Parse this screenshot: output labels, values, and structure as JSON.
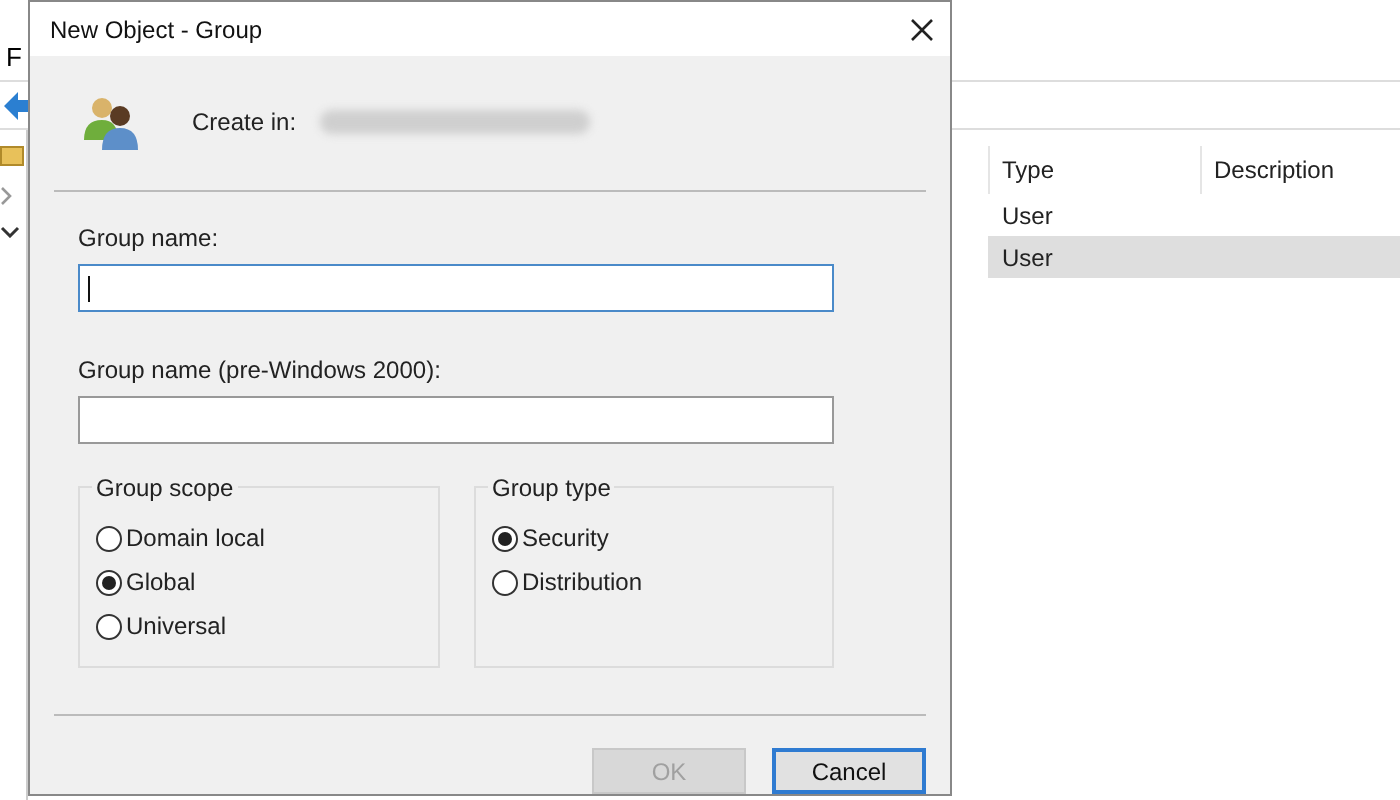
{
  "background": {
    "menu_letter": "F",
    "table": {
      "columns": [
        "Type",
        "Description"
      ],
      "rows": [
        {
          "type": "User",
          "selected": false
        },
        {
          "type": "User",
          "selected": true
        }
      ]
    }
  },
  "dialog": {
    "title": "New Object - Group",
    "create_in_label": "Create in:",
    "fields": [
      {
        "label": "Group name:",
        "focused": true
      },
      {
        "label": "Group name (pre-Windows 2000):",
        "focused": false
      }
    ],
    "group_scope": {
      "title": "Group scope",
      "options": [
        {
          "label": "Domain local",
          "selected": false
        },
        {
          "label": "Global",
          "selected": true
        },
        {
          "label": "Universal",
          "selected": false
        }
      ]
    },
    "group_type": {
      "title": "Group type",
      "options": [
        {
          "label": "Security",
          "selected": true
        },
        {
          "label": "Distribution",
          "selected": false
        }
      ]
    },
    "buttons": [
      {
        "label": "OK",
        "disabled": true,
        "default": false
      },
      {
        "label": "Cancel",
        "disabled": false,
        "default": true
      }
    ]
  }
}
